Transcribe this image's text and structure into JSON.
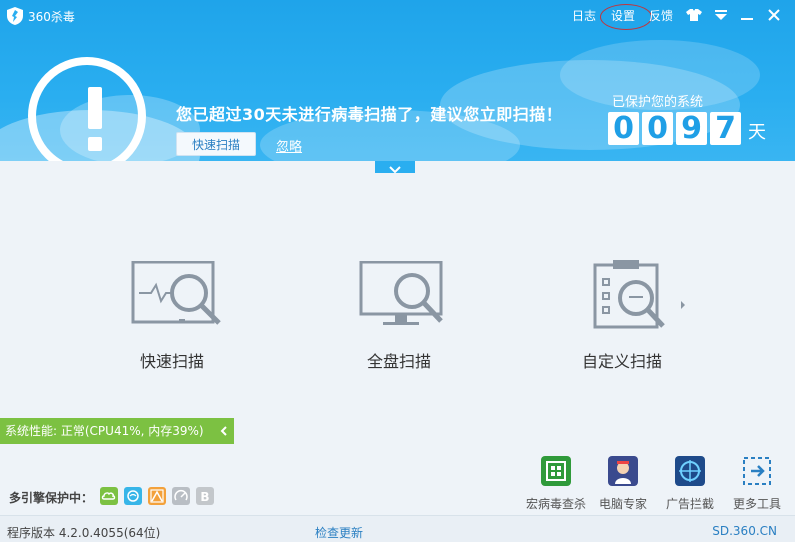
{
  "window": {
    "title": "360杀毒"
  },
  "titlebar": {
    "log": "日志",
    "settings": "设置",
    "feedback": "反馈"
  },
  "alert": {
    "message": "您已超过30天未进行病毒扫描了，建议您立即扫描！",
    "quick_scan": "快速扫描",
    "ignore": "忽略"
  },
  "protection": {
    "label": "已保护您的系统",
    "digits": [
      "0",
      "0",
      "9",
      "7"
    ],
    "unit": "天"
  },
  "scans": [
    {
      "label": "快速扫描"
    },
    {
      "label": "全盘扫描"
    },
    {
      "label": "自定义扫描"
    }
  ],
  "performance": {
    "text": "系统性能: 正常(CPU41%, 内存39%)"
  },
  "engines": {
    "label": "多引擎保护中：",
    "items": [
      "cloud-engine",
      "qvm-engine",
      "avira-engine",
      "system-repair-engine",
      "bitdefender-engine"
    ]
  },
  "tools": [
    {
      "label": "宏病毒查杀",
      "icon": "macro-virus-icon"
    },
    {
      "label": "电脑专家",
      "icon": "pc-expert-icon"
    },
    {
      "label": "广告拦截",
      "icon": "ad-block-icon"
    },
    {
      "label": "更多工具",
      "icon": "more-tools-icon"
    }
  ],
  "footer": {
    "version": "程序版本 4.2.0.4055(64位)",
    "update": "检查更新",
    "site": "SD.360.CN"
  },
  "colors": {
    "header_blue": "#2aaef0",
    "perf_green": "#7cc142",
    "link_blue": "#2a7fc2"
  }
}
